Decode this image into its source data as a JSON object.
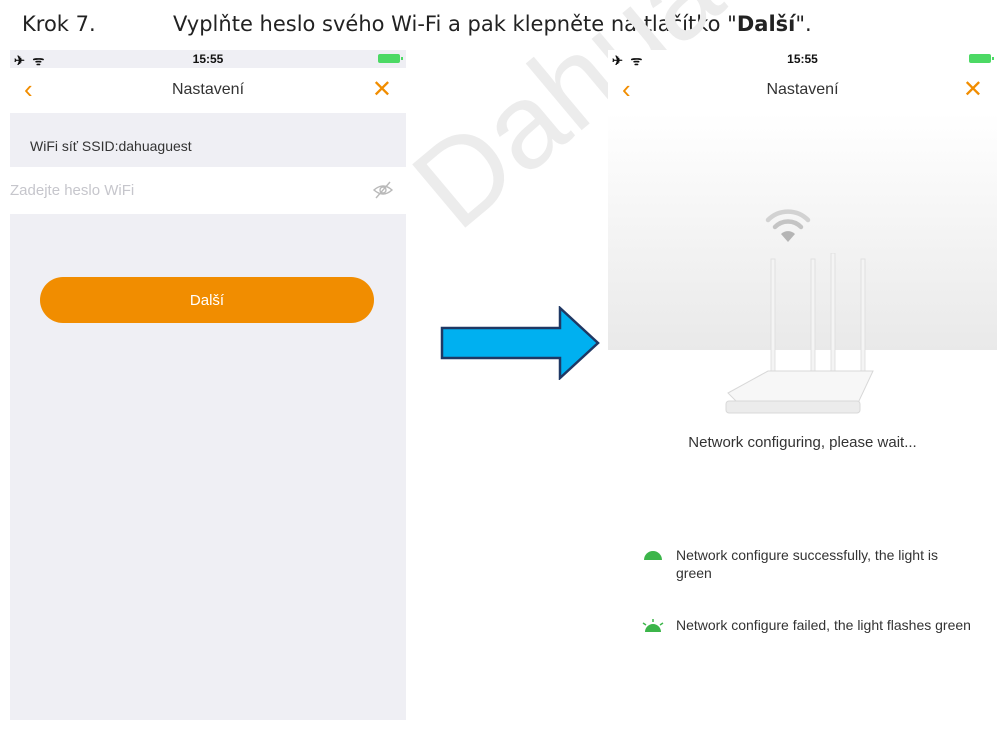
{
  "caption": {
    "step": "Krok 7.",
    "text": "Vyplňte heslo svého Wi-Fi a pak klepněte na tlačítko \"",
    "bold": "Další",
    "end": "\"."
  },
  "watermark": "Dahua",
  "left_screen": {
    "status": {
      "time": "15:55"
    },
    "nav": {
      "title": "Nastavení"
    },
    "ssid_label": "WiFi síť SSID:dahuaguest",
    "password_placeholder": "Zadejte heslo WiFi",
    "password_value": "",
    "next_button": "Další"
  },
  "right_screen": {
    "status": {
      "time": "15:55"
    },
    "nav": {
      "title": "Nastavení"
    },
    "configuring_text": "Network configuring, please wait...",
    "legend": [
      {
        "icon": "solid-green-light-icon",
        "text": "Network configure successfully, the light is green"
      },
      {
        "icon": "flashing-green-light-icon",
        "text": "Network configure failed, the light flashes green"
      }
    ]
  },
  "colors": {
    "accent": "#f18d00",
    "arrow_fill": "#00b0f0",
    "arrow_stroke": "#1f3864",
    "green": "#3cb54a",
    "battery": "#4cd964"
  }
}
